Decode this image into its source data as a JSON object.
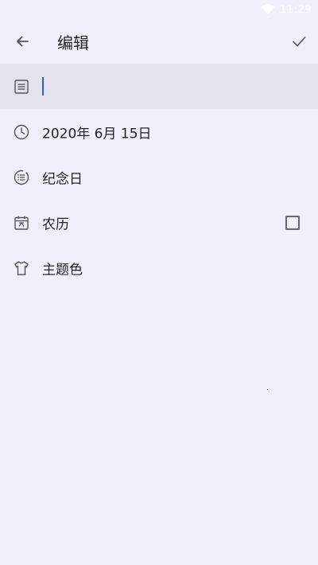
{
  "status_bar": {
    "time": "11:29"
  },
  "toolbar": {
    "title": "编辑"
  },
  "form": {
    "title_value": "",
    "date_label": "2020年 6月 15日",
    "type_label": "纪念日",
    "lunar_label": "农历",
    "lunar_checked": false,
    "theme_label": "主题色"
  },
  "colors": {
    "background": "#f0f0fc",
    "active_row": "#e3e3ee",
    "caret": "#3b5bd6",
    "icon": "#555555"
  },
  "icons": {
    "back": "arrow-left-icon",
    "done": "check-icon",
    "title": "text-box-icon",
    "date": "clock-icon",
    "type": "list-circle-icon",
    "lunar": "calendar-icon",
    "theme": "tshirt-icon",
    "wifi": "wifi-icon"
  }
}
